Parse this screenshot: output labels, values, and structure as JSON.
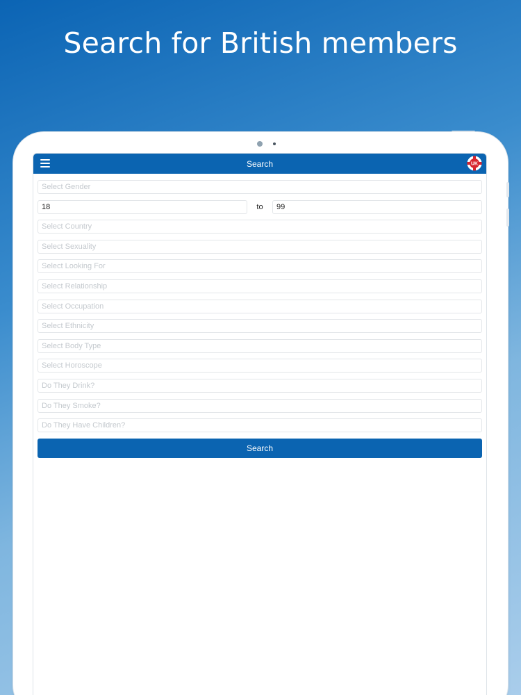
{
  "headline": "Search for British members",
  "navbar": {
    "title": "Search",
    "menu_icon": "hamburger-menu-icon",
    "flag_icon": "uk-flag-icon",
    "flag_text": "UK"
  },
  "form": {
    "gender_placeholder": "Select Gender",
    "age_min": "18",
    "age_separator": "to",
    "age_max": "99",
    "country_placeholder": "Select Country",
    "sexuality_placeholder": "Select Sexuality",
    "looking_for_placeholder": "Select Looking For",
    "relationship_placeholder": "Select Relationship",
    "occupation_placeholder": "Select Occupation",
    "ethnicity_placeholder": "Select Ethnicity",
    "body_type_placeholder": "Select Body Type",
    "horoscope_placeholder": "Select Horoscope",
    "drink_placeholder": "Do They Drink?",
    "smoke_placeholder": "Do They Smoke?",
    "children_placeholder": "Do They Have Children?",
    "search_label": "Search"
  },
  "colors": {
    "primary": "#0b64b1",
    "background_top": "#0b64b4",
    "background_bottom": "#a9cdeb",
    "flag_red": "#d7262f"
  }
}
